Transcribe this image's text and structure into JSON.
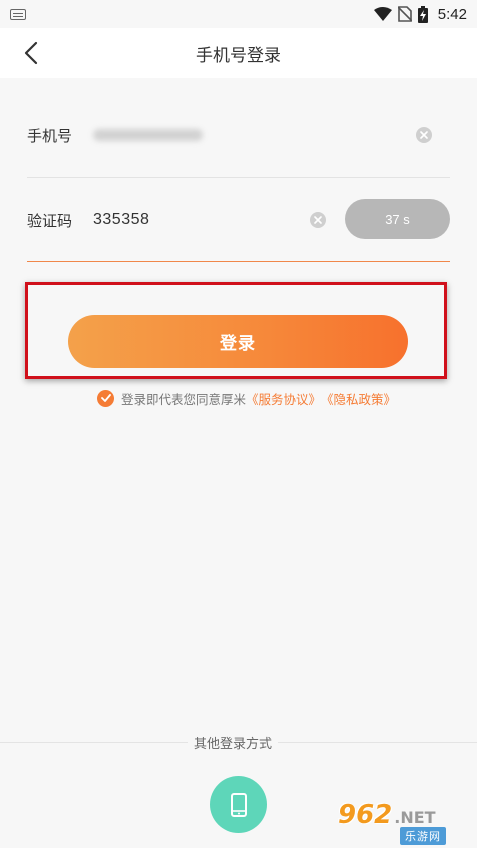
{
  "status_bar": {
    "time": "5:42",
    "icons": [
      "keyboard-icon",
      "wifi-icon",
      "no-sim-icon",
      "battery-charging-icon"
    ]
  },
  "header": {
    "title": "手机号登录",
    "back_icon": "chevron-left-icon"
  },
  "form": {
    "phone": {
      "label": "手机号",
      "value_blurred": true
    },
    "code": {
      "label": "验证码",
      "value": "335358"
    },
    "countdown_label": "37 s"
  },
  "login_button": "登录",
  "agreement": {
    "checked": true,
    "prefix": "登录即代表您同意厚米",
    "terms_link": "《服务协议》",
    "privacy_link": "《隐私政策》"
  },
  "other_methods": {
    "label": "其他登录方式",
    "phone_icon": "mobile-phone-icon"
  },
  "watermark": {
    "brand": "962",
    "suffix": ".NET",
    "sub": "乐游网"
  },
  "colors": {
    "accent": "#f57c35",
    "countdown_bg": "#b7b7b7",
    "phone_login_bg": "#5ed6b9",
    "highlight": "#d0101b"
  }
}
